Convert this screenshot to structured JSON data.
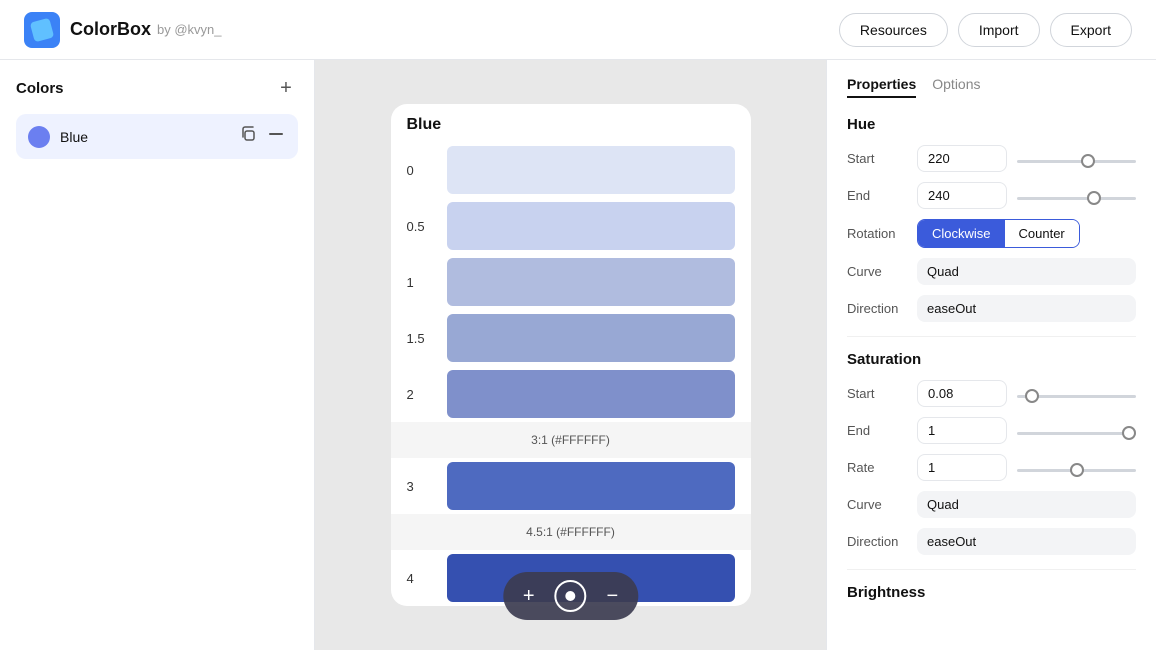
{
  "header": {
    "logo_alt": "ColorBox logo",
    "title": "ColorBox",
    "subtitle": "by @kvyn_",
    "resources_label": "Resources",
    "import_label": "Import",
    "export_label": "Export"
  },
  "sidebar": {
    "title": "Colors",
    "add_label": "+",
    "colors": [
      {
        "name": "Blue",
        "swatch": "#6b7ff0"
      }
    ]
  },
  "canvas": {
    "palette_title": "Blue",
    "swatches": [
      {
        "label": "0",
        "color": "#dde4f5",
        "contrast": null
      },
      {
        "label": "0.5",
        "color": "#c8d2ef",
        "contrast": null
      },
      {
        "label": "1",
        "color": "#b0bcdf",
        "contrast": null
      },
      {
        "label": "1.5",
        "color": "#98a8d4",
        "contrast": null
      },
      {
        "label": "2",
        "color": "#7f90cb",
        "contrast": "3:1 (#FFFFFF)"
      },
      {
        "label": "3",
        "color": "#4e6ac0",
        "contrast": "4.5:1 (#FFFFFF)"
      },
      {
        "label": "4",
        "color": "#3550b0",
        "contrast": null
      }
    ],
    "toolbar": {
      "add_label": "+",
      "center_label": "⊙",
      "remove_label": "−"
    }
  },
  "properties": {
    "tab_properties": "Properties",
    "tab_options": "Options",
    "hue": {
      "section_title": "Hue",
      "start_label": "Start",
      "start_value": "220",
      "end_label": "End",
      "end_value": "240",
      "rotation_label": "Rotation",
      "rotation_clockwise": "Clockwise",
      "rotation_counter": "Counter",
      "curve_label": "Curve",
      "curve_value": "Quad",
      "direction_label": "Direction",
      "direction_value": "easeOut"
    },
    "saturation": {
      "section_title": "Saturation",
      "start_label": "Start",
      "start_value": "0.08",
      "end_label": "End",
      "end_value": "1",
      "rate_label": "Rate",
      "rate_value": "1",
      "curve_label": "Curve",
      "curve_value": "Quad",
      "direction_label": "Direction",
      "direction_value": "easeOut"
    },
    "brightness": {
      "section_title": "Brightness"
    }
  }
}
